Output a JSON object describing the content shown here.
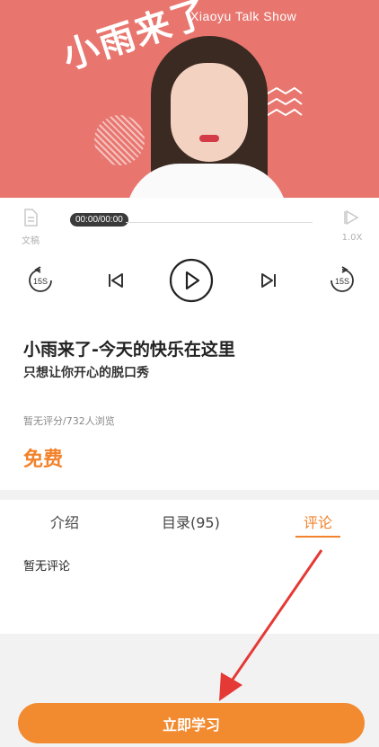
{
  "cover": {
    "title": "小雨来了",
    "subtitle": "Xiaoyu Talk Show"
  },
  "player": {
    "doc_label": "文稿",
    "time": "00:00/00:00",
    "speed": "1.0X",
    "rewind_label": "15S",
    "forward_label": "15S"
  },
  "course": {
    "title": "小雨来了-今天的快乐在这里",
    "subtitle": "只想让你开心的脱口秀",
    "stats": "暂无评分/732人浏览",
    "price": "免费"
  },
  "tabs": [
    {
      "label": "介绍"
    },
    {
      "label": "目录(95)"
    },
    {
      "label": "评论"
    }
  ],
  "comments": {
    "empty_text": "暂无评论"
  },
  "cta": {
    "label": "立即学习"
  },
  "colors": {
    "accent": "#f2822b",
    "cover_bg": "#e8766f",
    "annotation_arrow": "#e53935"
  }
}
